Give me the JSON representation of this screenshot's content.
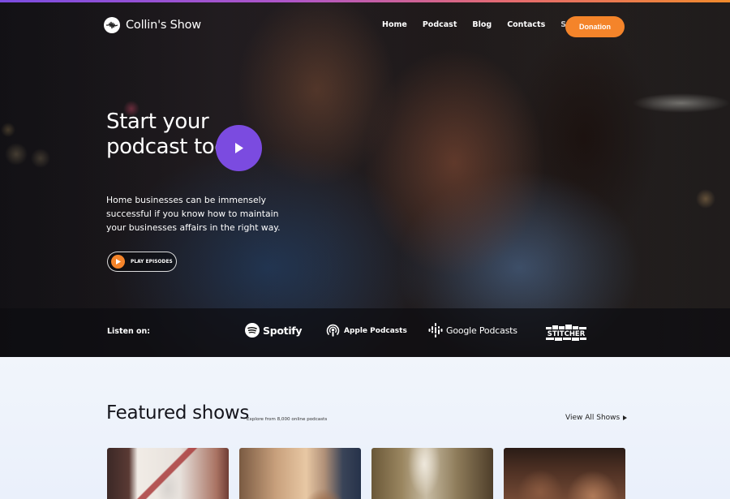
{
  "nav": {
    "brand": "Collin's Show",
    "links": [
      "Home",
      "Podcast",
      "Blog",
      "Contacts",
      "Store"
    ],
    "donation_label": "Donation"
  },
  "hero": {
    "title": "Start your podcast today!",
    "description": "Home businesses can be immensely successful if you know how to maintain your businesses affairs in the right way.",
    "play_episodes_label": "PLAY EPISODES"
  },
  "listen": {
    "label": "Listen on:",
    "platforms": [
      "Spotify",
      "Apple Podcasts",
      "Google Podcasts",
      "STITCHER"
    ]
  },
  "featured": {
    "title": "Featured shows",
    "subtitle": "Explore from 8,000 online podcasts",
    "view_all_label": "View All Shows"
  },
  "colors": {
    "accent_orange": "#f4842a",
    "accent_purple": "#7b4be0"
  }
}
